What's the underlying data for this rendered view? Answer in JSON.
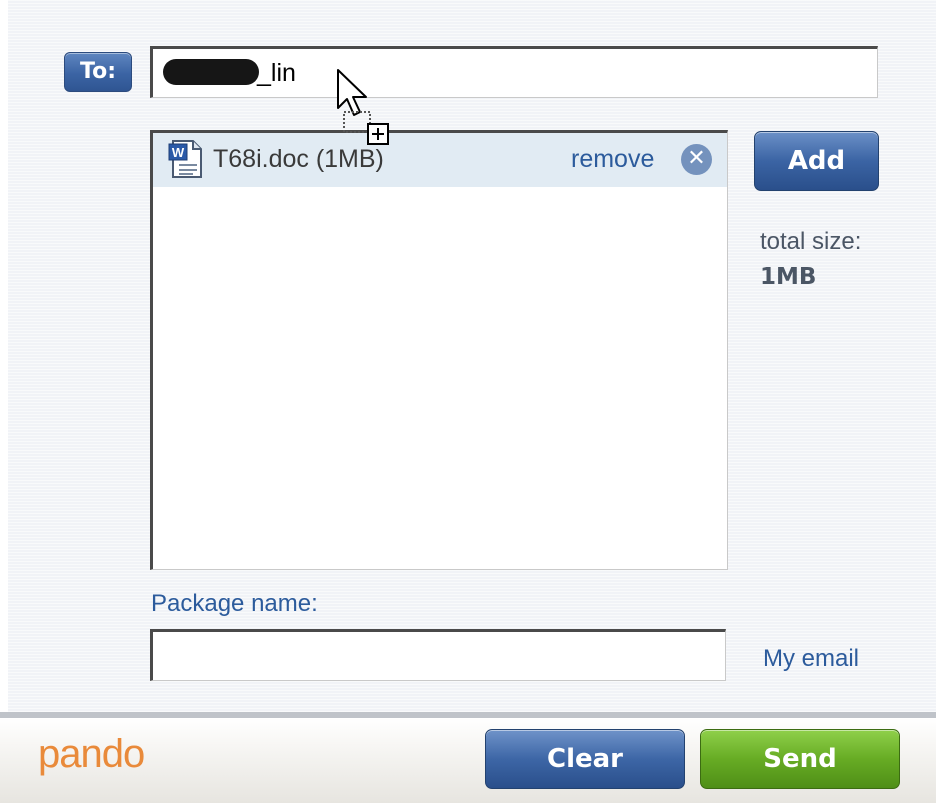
{
  "recipient": {
    "label": "To:",
    "value": "_lin"
  },
  "files": [
    {
      "icon": "word-document-icon",
      "name": "T68i.doc (1MB)",
      "remove_label": "remove"
    }
  ],
  "actions": {
    "add_label": "Add"
  },
  "totals": {
    "label": "total size:",
    "value": "1MB"
  },
  "package": {
    "label": "Package name:",
    "value": "",
    "my_email_label": "My email"
  },
  "footer": {
    "brand": "pando",
    "clear_label": "Clear",
    "send_label": "Send"
  },
  "colors": {
    "button_blue": "#3b64a4",
    "send_green": "#67ac24",
    "link_blue": "#2c5b9c",
    "brand_orange": "#e98a3a",
    "selected_row": "#e1ebf3"
  }
}
